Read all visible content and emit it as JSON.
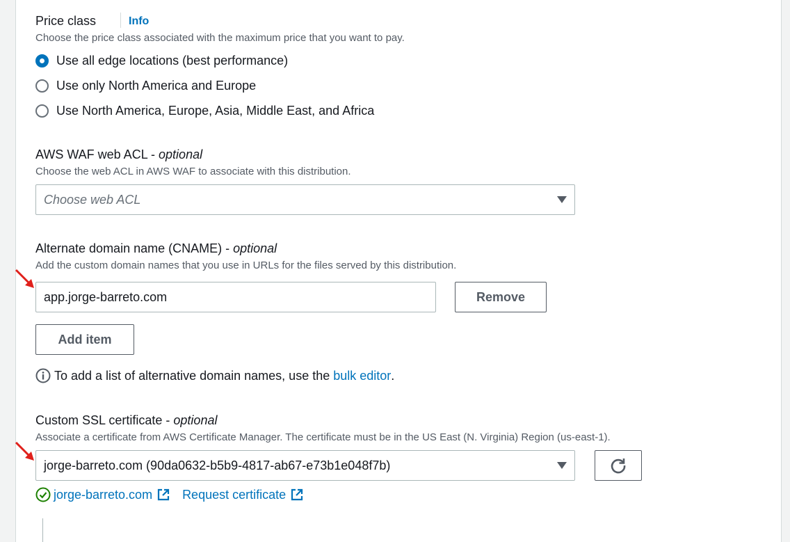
{
  "price_class": {
    "label": "Price class",
    "info_link": "Info",
    "description": "Choose the price class associated with the maximum price that you want to pay.",
    "options": [
      {
        "label": "Use all edge locations (best performance)",
        "checked": true
      },
      {
        "label": "Use only North America and Europe",
        "checked": false
      },
      {
        "label": "Use North America, Europe, Asia, Middle East, and Africa",
        "checked": false
      }
    ]
  },
  "waf": {
    "label": "AWS WAF web ACL - ",
    "optional": "optional",
    "description": "Choose the web ACL in AWS WAF to associate with this distribution.",
    "placeholder": "Choose web ACL"
  },
  "cname": {
    "label": "Alternate domain name (CNAME) - ",
    "optional": "optional",
    "description": "Add the custom domain names that you use in URLs for the files served by this distribution.",
    "value": "app.jorge-barreto.com",
    "remove_label": "Remove",
    "add_item_label": "Add item",
    "hint_prefix": "To add a list of alternative domain names, use the ",
    "hint_link": "bulk editor",
    "hint_suffix": "."
  },
  "ssl": {
    "label": "Custom SSL certificate - ",
    "optional": "optional",
    "description": "Associate a certificate from AWS Certificate Manager. The certificate must be in the US East (N. Virginia) Region (us-east-1).",
    "selected": "jorge-barreto.com (90da0632-b5b9-4817-ab67-e73b1e048f7b)",
    "cert_link": "jorge-barreto.com",
    "request_link": "Request certificate"
  },
  "colors": {
    "accent": "#0073bb",
    "success": "#1d8102",
    "annotation_arrow": "#e0201b"
  },
  "icons": {
    "refresh": "refresh-icon",
    "external": "external-link-icon",
    "success": "success-check-icon",
    "info": "info-circle-icon"
  }
}
